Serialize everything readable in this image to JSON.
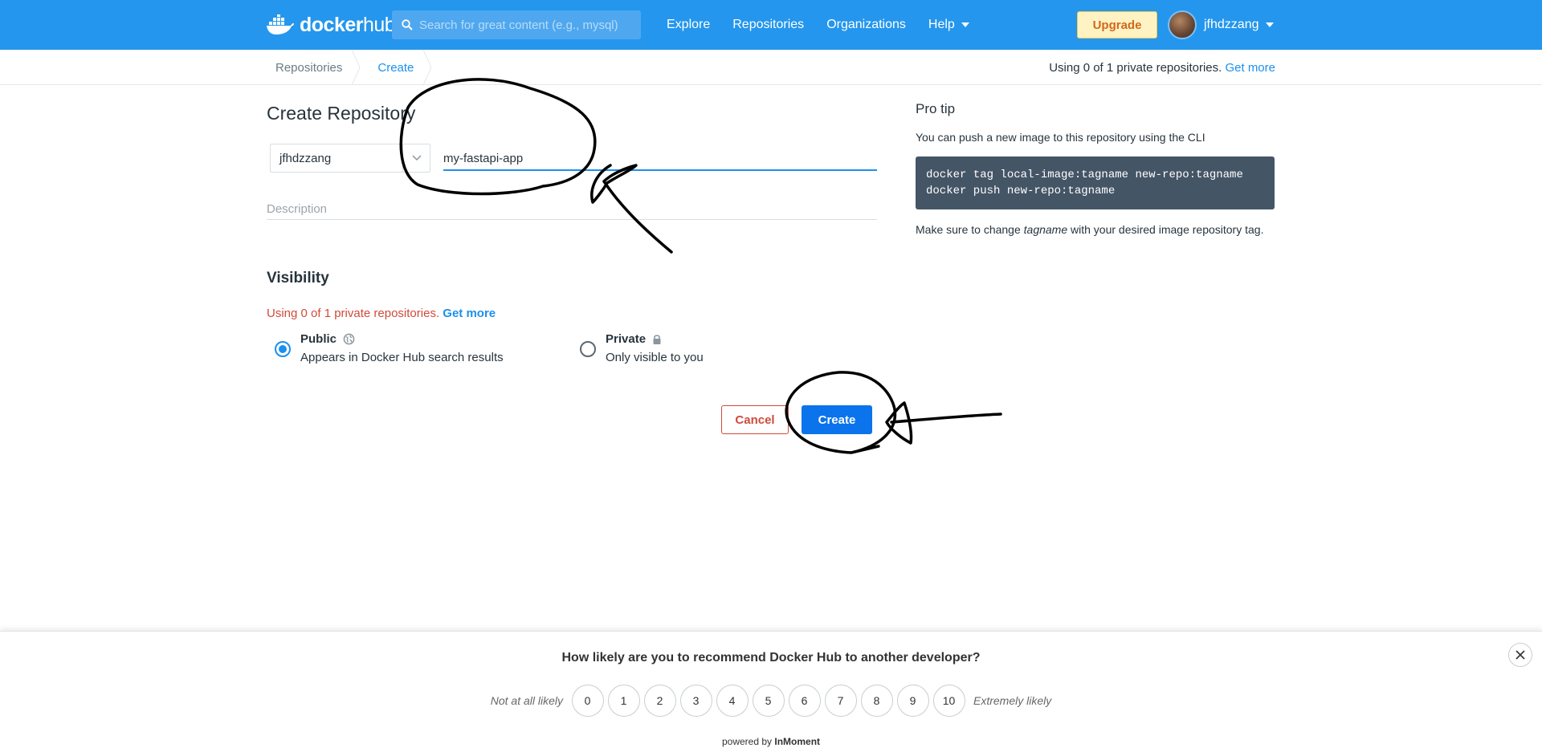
{
  "nav": {
    "logo_bold": "docker",
    "logo_rest": "hub",
    "search_placeholder": "Search for great content (e.g., mysql)",
    "links": [
      "Explore",
      "Repositories",
      "Organizations",
      "Help"
    ],
    "upgrade_label": "Upgrade",
    "username": "jfhdzzang",
    "brand_color": "#2496ed"
  },
  "breadcrumb": {
    "items": [
      "Repositories",
      "Create"
    ],
    "usage_text": "Using 0 of 1 private repositories.",
    "usage_link": "Get more"
  },
  "form": {
    "title": "Create Repository",
    "namespace": "jfhdzzang",
    "repo_name": "my-fastapi-app",
    "description_placeholder": "Description",
    "visibility_title": "Visibility",
    "visibility_warning": "Using 0 of 1 private repositories.",
    "visibility_link": "Get more",
    "options": [
      {
        "title": "Public",
        "subtitle": "Appears in Docker Hub search results",
        "checked": true,
        "icon": "globe-icon"
      },
      {
        "title": "Private",
        "subtitle": "Only visible to you",
        "checked": false,
        "icon": "lock-icon"
      }
    ],
    "cancel_label": "Cancel",
    "create_label": "Create"
  },
  "pro_tip": {
    "title": "Pro tip",
    "intro": "You can push a new image to this repository using the CLI",
    "code_line1": "docker tag local-image:tagname new-repo:tagname",
    "code_line2": "docker push new-repo:tagname",
    "note_before": "Make sure to change ",
    "note_em": "tagname",
    "note_after": " with your desired image repository tag."
  },
  "survey": {
    "question": "How likely are you to recommend Docker Hub to another developer?",
    "low_label": "Not at all likely",
    "high_label": "Extremely likely",
    "scale": [
      "0",
      "1",
      "2",
      "3",
      "4",
      "5",
      "6",
      "7",
      "8",
      "9",
      "10"
    ],
    "powered_prefix": "powered by",
    "powered_brand": "InMoment"
  }
}
